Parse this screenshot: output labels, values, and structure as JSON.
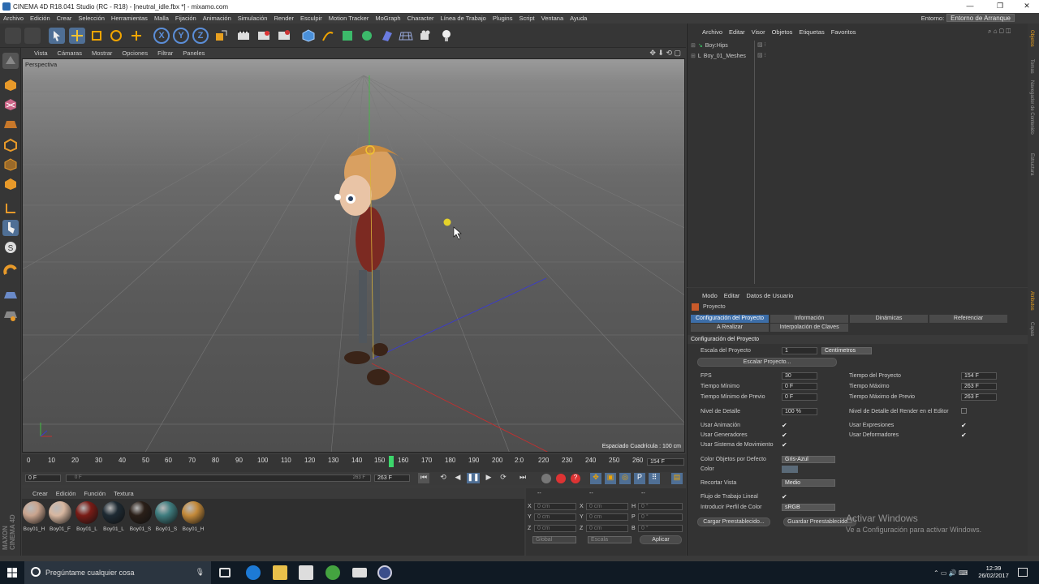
{
  "window": {
    "title": "CINEMA 4D R18.041 Studio (RC - R18) - [neutral_idle.fbx *] - mixamo.com"
  },
  "menu": [
    "Archivo",
    "Edición",
    "Crear",
    "Selección",
    "Herramientas",
    "Malla",
    "Fijación",
    "Animación",
    "Simulación",
    "Render",
    "Esculpir",
    "Motion Tracker",
    "MoGraph",
    "Character",
    "Línea de Trabajo",
    "Plugins",
    "Script",
    "Ventana",
    "Ayuda"
  ],
  "environment": {
    "label": "Entorno:",
    "value": "Entorno de Arranque"
  },
  "viewport": {
    "menu": [
      "Vista",
      "Cámaras",
      "Mostrar",
      "Opciones",
      "Filtrar",
      "Paneles"
    ],
    "camera": "Perspectiva",
    "grid_spacing": "Espaciado Cuadrícula : 100 cm"
  },
  "timeline": {
    "ticks": [
      "0",
      "10",
      "20",
      "30",
      "40",
      "50",
      "60",
      "70",
      "80",
      "90",
      "100",
      "110",
      "120",
      "130",
      "140",
      "150",
      "160",
      "170",
      "180",
      "190",
      "200",
      "2:0",
      "220",
      "230",
      "240",
      "250",
      "260"
    ],
    "end_field": "154 F",
    "current_frame": "0 F",
    "range_start": "0 F",
    "range_end": "263 F",
    "max_field": "263 F",
    "slider_label": "263 F"
  },
  "materials": {
    "menu": [
      "Crear",
      "Edición",
      "Función",
      "Textura"
    ],
    "items": [
      {
        "name": "Boy01_H",
        "color": "#c9a48e"
      },
      {
        "name": "Boy01_F",
        "color": "#d8b7a0"
      },
      {
        "name": "Boy01_L",
        "color": "#7a1c16"
      },
      {
        "name": "Boy01_L",
        "color": "#1e2a33"
      },
      {
        "name": "Boy01_S",
        "color": "#2a1f18"
      },
      {
        "name": "Boy01_S",
        "color": "#3f7d7f"
      },
      {
        "name": "Boy01_H",
        "color": "#c48a3a"
      }
    ]
  },
  "coords": {
    "rows": [
      {
        "a": "X",
        "av": "0 cm",
        "b": "X",
        "bv": "0 cm",
        "c": "H",
        "cv": "0 °"
      },
      {
        "a": "Y",
        "av": "0 cm",
        "b": "Y",
        "bv": "0 cm",
        "c": "P",
        "cv": "0 °"
      },
      {
        "a": "Z",
        "av": "0 cm",
        "b": "Z",
        "bv": "0 cm",
        "c": "B",
        "cv": "0 °"
      }
    ],
    "mode1": "Global",
    "mode2": "Escala",
    "apply": "Aplicar",
    "header1": "--",
    "header2": "--",
    "header3": "--"
  },
  "object_manager": {
    "menu": [
      "Archivo",
      "Editar",
      "Visor",
      "Objetos",
      "Etiquetas",
      "Favoritos"
    ],
    "objects": [
      "Boy:Hips",
      "Boy_01_Meshes"
    ]
  },
  "attributes": {
    "menu": [
      "Modo",
      "Editar",
      "Datos de Usuario"
    ],
    "object": "Proyecto",
    "tabs_row1": [
      "Configuración del Proyecto",
      "Información",
      "Dinámicas",
      "Referenciar"
    ],
    "tabs_row2": [
      "A Realizar",
      "Interpolación de Claves"
    ],
    "section": "Configuración del Proyecto",
    "scale_label": "Escala del Proyecto",
    "scale_value": "1",
    "scale_unit": "Centímetros",
    "scale_button": "Escalar Proyecto...",
    "fps_label": "FPS",
    "fps_value": "30",
    "min_time_label": "Tiempo Mínimo",
    "min_time_value": "0 F",
    "min_preview_label": "Tiempo Mínimo de Previo",
    "min_preview_value": "0 F",
    "project_time_label": "Tiempo del Proyecto",
    "project_time_value": "154 F",
    "max_time_label": "Tiempo Máximo",
    "max_time_value": "263 F",
    "max_preview_label": "Tiempo Máximo de Previo",
    "max_preview_value": "263 F",
    "lod_label": "Nivel de Detalle",
    "lod_value": "100 %",
    "render_lod_label": "Nivel de Detalle del Render en el Editor",
    "use_anim_label": "Usar Animación",
    "use_expr_label": "Usar Expresiones",
    "use_gen_label": "Usar Generadores",
    "use_deform_label": "Usar Deformadores",
    "use_motion_label": "Usar Sistema de Movimiento",
    "obj_color_label": "Color Objetos por Defecto",
    "obj_color_value": "Gris-Azul",
    "color_label": "Color",
    "crop_label": "Recortar Vista",
    "crop_value": "Medio",
    "linear_label": "Flujo de Trabajo Lineal",
    "profile_label": "Introducir Perfil de Color",
    "profile_value": "sRGB",
    "load_preset": "Cargar Preestablecido...",
    "save_preset": "Guardar Preestablecido...",
    "check": "✔"
  },
  "right_strip": [
    "Objetos",
    "Tomas",
    "Navegador de Contenido",
    "Estructura",
    "Atributos",
    "Capas"
  ],
  "watermark": {
    "line1": "Activar Windows",
    "line2": "Ve a Configuración para activar Windows."
  },
  "taskbar": {
    "search_placeholder": "Pregúntame cualquier cosa",
    "time": "12:39",
    "date": "26/02/2017"
  },
  "brand": "MAXON CINEMA 4D"
}
